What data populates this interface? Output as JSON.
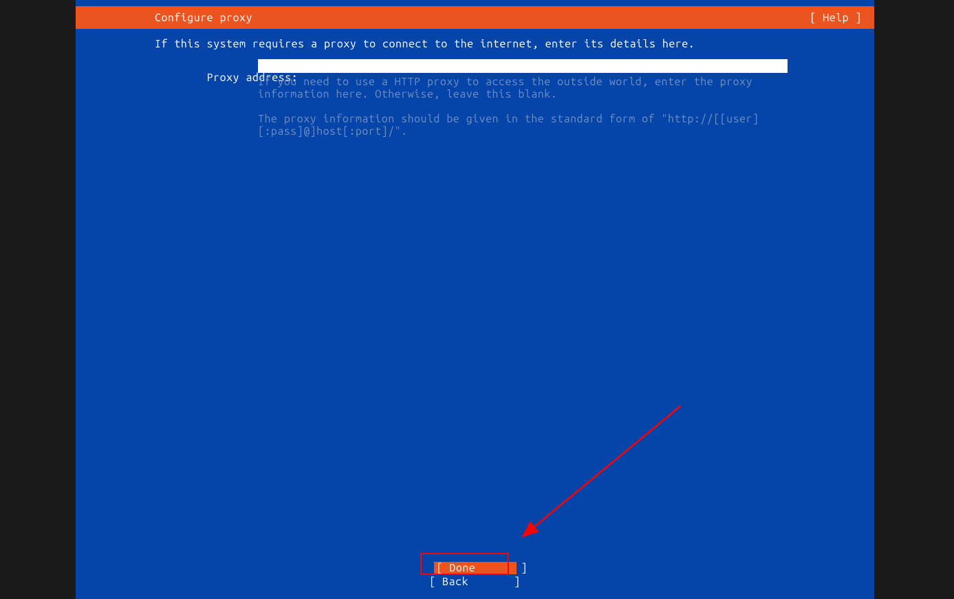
{
  "header": {
    "title": "Configure proxy",
    "help_label": "[ Help ]"
  },
  "intro": "If this system requires a proxy to connect to the internet, enter its details here.",
  "form": {
    "proxy_label": "Proxy address:",
    "proxy_value": "",
    "hint1": "If you need to use a HTTP proxy to access the outside world, enter the proxy information here. Otherwise, leave this blank.",
    "hint2": "The proxy information should be given in the standard form of \"http://[[user][:pass]@]host[:port]/\"."
  },
  "buttons": {
    "done": "[ Done       ]",
    "back": "[ Back       ]"
  }
}
